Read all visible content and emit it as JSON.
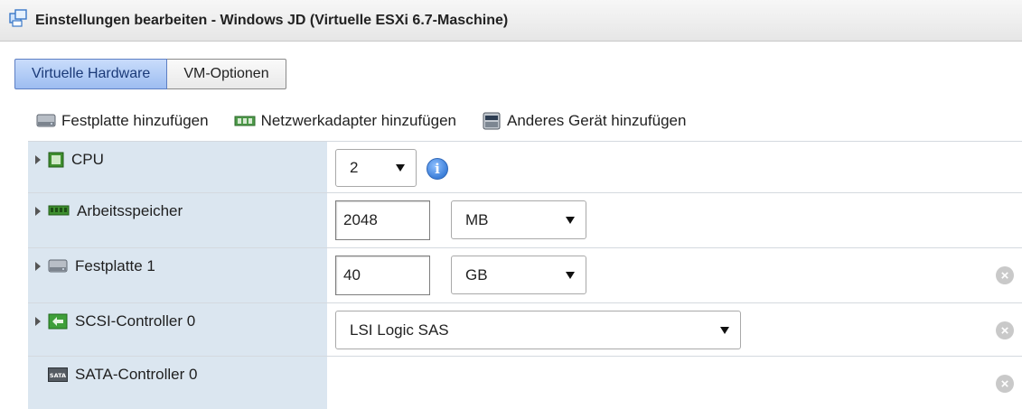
{
  "window": {
    "title": "Einstellungen bearbeiten - Windows JD (Virtuelle ESXi 6.7-Maschine)",
    "icon": "vm-edit-icon"
  },
  "tabs": [
    {
      "label": "Virtuelle Hardware",
      "active": true
    },
    {
      "label": "VM-Optionen",
      "active": false
    }
  ],
  "toolbar": {
    "add_disk": "Festplatte hinzufügen",
    "add_network": "Netzwerkadapter hinzufügen",
    "add_other": "Anderes Gerät hinzufügen"
  },
  "devices": {
    "cpu": {
      "label": "CPU",
      "value": "2",
      "icon": "cpu-icon"
    },
    "memory": {
      "label": "Arbeitsspeicher",
      "value": "2048",
      "unit": "MB",
      "icon": "memory-icon"
    },
    "disk1": {
      "label": "Festplatte 1",
      "value": "40",
      "unit": "GB",
      "icon": "hard-disk-icon"
    },
    "scsi": {
      "label": "SCSI-Controller 0",
      "value": "LSI Logic SAS",
      "icon": "scsi-controller-icon"
    },
    "sata": {
      "label": "SATA-Controller 0",
      "icon": "sata-controller-icon",
      "icon_text": "SATA"
    }
  },
  "colors": {
    "active_tab": "#9dbdf1",
    "label_column": "#dbe6f0",
    "info": "#3c7fd9"
  }
}
